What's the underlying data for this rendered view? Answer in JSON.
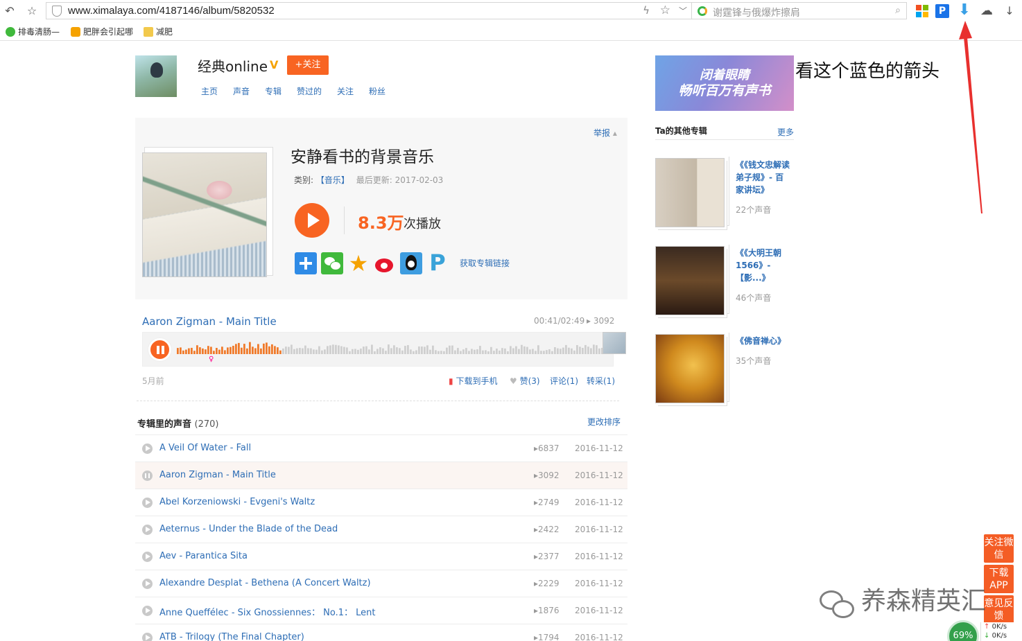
{
  "browser": {
    "url": "www.ximalaya.com/4187146/album/5820532",
    "search_placeholder": "谢霆锋与俄爆炸擦肩",
    "bookmarks": [
      "排毒清肠—",
      "肥胖会引起哪",
      "减肥"
    ]
  },
  "user": {
    "name": "经典online",
    "verified_badge": "V",
    "follow_label": "+关注",
    "nav": [
      "主页",
      "声音",
      "专辑",
      "赞过的",
      "关注",
      "粉丝"
    ]
  },
  "album": {
    "report_label": "举报",
    "title": "安静看书的背景音乐",
    "category_label": "类别:",
    "category": "【音乐】",
    "updated": "最后更新: 2017-02-03",
    "plays": "8.3万",
    "plays_label": "次播放",
    "get_link": "获取专辑链接"
  },
  "player": {
    "track_title": "Aaron Zigman - Main Title",
    "time": "00:41/02:49",
    "plays": "3092",
    "progress": 0.243,
    "posted": "5月前",
    "actions": [
      "下载到手机",
      "赞(3)",
      "评论(1)",
      "转采(1)"
    ]
  },
  "track_list": {
    "heading": "专辑里的声音",
    "count": "(270)",
    "sort_label": "更改排序",
    "rows": [
      {
        "name": "A Veil Of Water - Fall",
        "plays": "6837",
        "date": "2016-11-12"
      },
      {
        "name": "Aaron Zigman - Main Title",
        "plays": "3092",
        "date": "2016-11-12"
      },
      {
        "name": "Abel Korzeniowski - Evgeni's Waltz",
        "plays": "2749",
        "date": "2016-11-12"
      },
      {
        "name": "Aeternus - Under the Blade of the Dead",
        "plays": "2422",
        "date": "2016-11-12"
      },
      {
        "name": "Aev - Parantica Sita",
        "plays": "2377",
        "date": "2016-11-12"
      },
      {
        "name": "Alexandre Desplat - Bethena (A Concert Waltz)",
        "plays": "2229",
        "date": "2016-11-12"
      },
      {
        "name": "Anne Queffélec - Six Gnossiennes： No.1： Lent",
        "plays": "1876",
        "date": "2016-11-12"
      },
      {
        "name": "ATB - Trilogy (The Final Chapter)",
        "plays": "1794",
        "date": "2016-11-12"
      }
    ]
  },
  "sidebar": {
    "banner_line1": "闭着眼睛",
    "banner_line2": "畅听百万有声书",
    "annotation": "看这个蓝色的箭头",
    "other_heading": "Ta的其他专辑",
    "more_label": "更多",
    "albums": [
      {
        "title": "《《钱文忠解读弟子规》- 百家讲坛》",
        "count": "22个声音"
      },
      {
        "title": "《《大明王朝1566》- 【影...》",
        "count": "46个声音"
      },
      {
        "title": "《佛音禅心》",
        "count": "35个声音"
      }
    ]
  },
  "widgets": {
    "follow_wechat": "关注微信",
    "download_app": "下载APP",
    "feedback": "意见反馈",
    "watermark": "养森精英汇",
    "speed": "69%",
    "net_up": "0K/s",
    "net_down": "0K/s"
  },
  "colors": {
    "accent_orange": "#f86422",
    "link_blue": "#2d6db5",
    "arrow_red": "#e8302e"
  }
}
